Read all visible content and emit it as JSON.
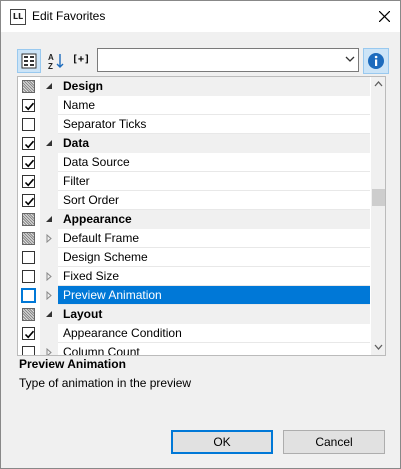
{
  "window": {
    "title": "Edit Favorites",
    "app_icon_text": "LL"
  },
  "toolbar": {
    "search_value": "",
    "expand_label": "[+]",
    "sort_label_top": "A",
    "sort_label_bottom": "Z"
  },
  "rows": [
    {
      "type": "category",
      "label": "Design",
      "check": "indeterminate",
      "expand": "expanded"
    },
    {
      "type": "item",
      "label": "Name",
      "check": "checked",
      "expand": "none"
    },
    {
      "type": "item",
      "label": "Separator Ticks",
      "check": "unchecked",
      "expand": "none"
    },
    {
      "type": "category",
      "label": "Data",
      "check": "checked",
      "expand": "expanded"
    },
    {
      "type": "item",
      "label": "Data Source",
      "check": "checked",
      "expand": "none"
    },
    {
      "type": "item",
      "label": "Filter",
      "check": "checked",
      "expand": "none"
    },
    {
      "type": "item",
      "label": "Sort Order",
      "check": "checked",
      "expand": "none"
    },
    {
      "type": "category",
      "label": "Appearance",
      "check": "indeterminate",
      "expand": "expanded"
    },
    {
      "type": "item",
      "label": "Default Frame",
      "check": "indeterminate",
      "expand": "collapsed"
    },
    {
      "type": "item",
      "label": "Design Scheme",
      "check": "unchecked",
      "expand": "none"
    },
    {
      "type": "item",
      "label": "Fixed Size",
      "check": "unchecked",
      "expand": "collapsed"
    },
    {
      "type": "item",
      "label": "Preview Animation",
      "check": "unchecked",
      "expand": "collapsed",
      "selected": true
    },
    {
      "type": "category",
      "label": "Layout",
      "check": "indeterminate",
      "expand": "expanded"
    },
    {
      "type": "item",
      "label": "Appearance Condition",
      "check": "checked",
      "expand": "none"
    },
    {
      "type": "item",
      "label": "Column Count",
      "check": "unchecked",
      "expand": "collapsed"
    }
  ],
  "description": {
    "title": "Preview Animation",
    "text": "Type of animation in the preview"
  },
  "buttons": {
    "ok": "OK",
    "cancel": "Cancel"
  },
  "colors": {
    "selection": "#0078d7",
    "toolbar_active": "#cce4f7",
    "info_icon": "#1c6bbd"
  },
  "icons": {
    "categorized": "categorized-view-icon",
    "sort": "sort-az-icon",
    "expand": "expand-all-icon",
    "info": "info-icon",
    "close": "close-icon"
  }
}
